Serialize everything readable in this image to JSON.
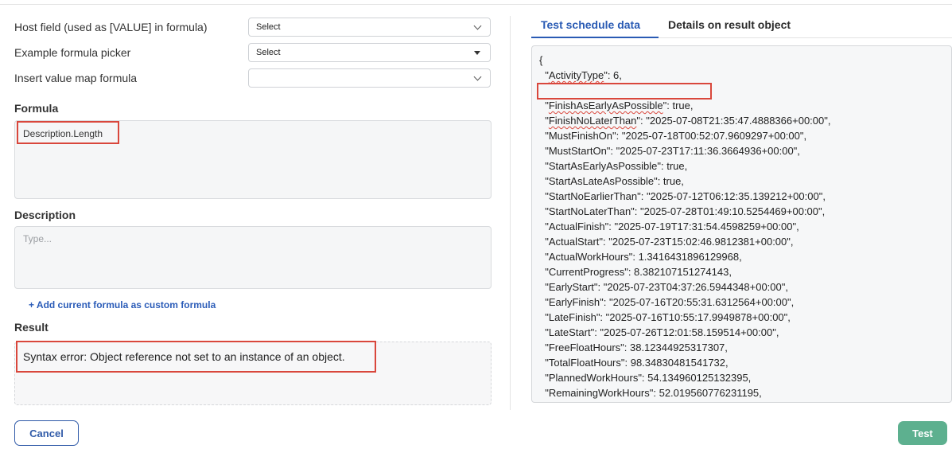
{
  "form": {
    "host_field_label": "Host field (used as [VALUE] in formula)",
    "host_field_value": "Select",
    "example_picker_label": "Example formula picker",
    "example_picker_value": "Select",
    "value_map_label": "Insert value map formula",
    "value_map_value": "",
    "formula_title": "Formula",
    "formula_value": "Description.Length",
    "description_title": "Description",
    "description_placeholder": "Type...",
    "add_custom_link": "+ Add current formula as custom formula",
    "result_title": "Result",
    "result_text": "Syntax error: Object reference not set to an instance of an object."
  },
  "buttons": {
    "cancel": "Cancel",
    "test": "Test"
  },
  "tabs": [
    {
      "label": "Test schedule data",
      "active": true
    },
    {
      "label": "Details on result object",
      "active": false
    }
  ],
  "json_lines": [
    "{",
    "  \"ActivityType\": 6,",
    "",
    "  \"FinishAsEarlyAsPossible\": true,",
    "  \"FinishNoLaterThan\": \"2025-07-08T21:35:47.4888366+00:00\",",
    "  \"MustFinishOn\": \"2025-07-18T00:52:07.9609297+00:00\",",
    "  \"MustStartOn\": \"2025-07-23T17:11:36.3664936+00:00\",",
    "  \"StartAsEarlyAsPossible\": true,",
    "  \"StartAsLateAsPossible\": true,",
    "  \"StartNoEarlierThan\": \"2025-07-12T06:12:35.139212+00:00\",",
    "  \"StartNoLaterThan\": \"2025-07-28T01:49:10.5254469+00:00\",",
    "  \"ActualFinish\": \"2025-07-19T17:31:54.4598259+00:00\",",
    "  \"ActualStart\": \"2025-07-23T15:02:46.9812381+00:00\",",
    "  \"ActualWorkHours\": 1.3416431896129968,",
    "  \"CurrentProgress\": 8.382107151274143,",
    "  \"EarlyStart\": \"2025-07-23T04:37:26.5944348+00:00\",",
    "  \"EarlyFinish\": \"2025-07-16T20:55:31.6312564+00:00\",",
    "  \"LateFinish\": \"2025-07-16T10:55:17.9949878+00:00\",",
    "  \"LateStart\": \"2025-07-26T12:01:58.159514+00:00\",",
    "  \"FreeFloatHours\": 38.12344925317307,",
    "  \"TotalFloatHours\": 98.34830481541732,",
    "  \"PlannedWorkHours\": 54.134960125132395,",
    "  \"RemainingWorkHours\": 52.019560776231195,"
  ],
  "colors": {
    "accent": "#2a5bb4",
    "highlight_border": "#d9473c",
    "test_button": "#5db08f"
  },
  "icons": [
    "chevron-down-icon",
    "caret-down-icon"
  ]
}
